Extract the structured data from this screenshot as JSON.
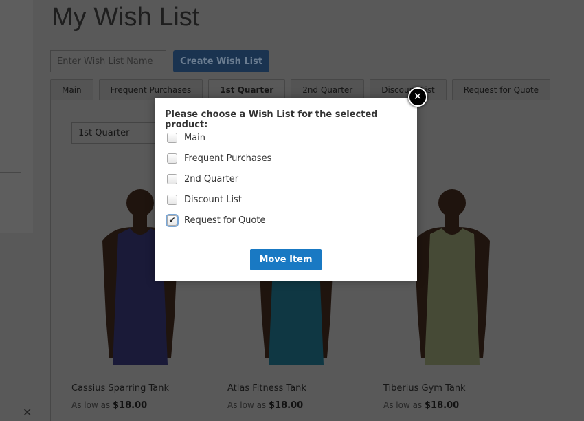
{
  "page": {
    "title": "My Wish List",
    "input_placeholder": "Enter Wish List Name",
    "create_label": "Create Wish List"
  },
  "tabs": [
    {
      "label": "Main"
    },
    {
      "label": "Frequent Purchases"
    },
    {
      "label": "1st Quarter",
      "active": true
    },
    {
      "label": "2nd Quarter"
    },
    {
      "label": "Discount List"
    },
    {
      "label": "Request for Quote"
    }
  ],
  "select_value": "1st Quarter",
  "products": [
    {
      "name": "Cassius Sparring Tank",
      "price_prefix": "As low as",
      "price": "$18.00",
      "color": "#4a4aa0"
    },
    {
      "name": "Atlas Fitness Tank",
      "price_prefix": "As low as",
      "price": "$18.00",
      "color": "#2a9cc0"
    },
    {
      "name": "Tiberius Gym Tank",
      "price_prefix": "As low as",
      "price": "$18.00",
      "color": "#c8d39a"
    }
  ],
  "modal": {
    "title": "Please choose a Wish List for the selected product:",
    "options": [
      {
        "label": "Main",
        "checked": false
      },
      {
        "label": "Frequent Purchases",
        "checked": false
      },
      {
        "label": "2nd Quarter",
        "checked": false
      },
      {
        "label": "Discount List",
        "checked": false
      },
      {
        "label": "Request for Quote",
        "checked": true
      }
    ],
    "move_label": "Move Item",
    "close_icon": "close-icon"
  },
  "colors": {
    "accent": "#1979c3",
    "overlay": "rgba(0,0,0,0.65)"
  }
}
